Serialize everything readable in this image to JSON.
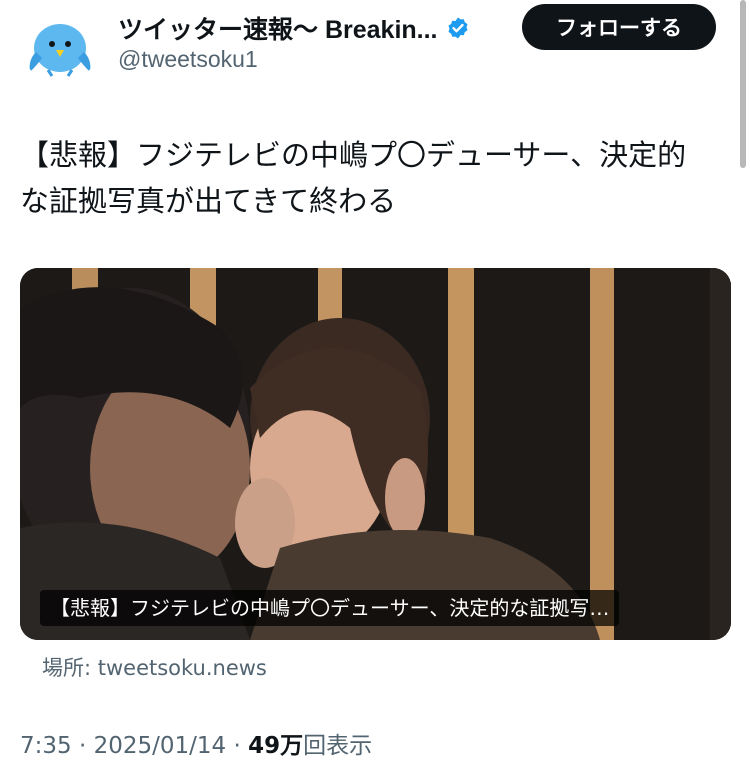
{
  "author": {
    "display_name": "ツイッター速報〜 Breakin...",
    "handle": "@tweetsoku1",
    "avatar_icon": "bird-avatar-icon",
    "verified_icon": "verified-badge-icon",
    "verified_color": "#1d9bf0"
  },
  "follow_button": {
    "label": "フォローする"
  },
  "tweet": {
    "text_line1": "【悲報】フジテレビの中嶋プ〇デューサー、決定的",
    "text_line2": "な証拠写真が出てきて終わる"
  },
  "media": {
    "caption": "【悲報】フジテレビの中嶋プ〇デューサー、決定的な証拠写…"
  },
  "link_source": "場所: tweetsoku.news",
  "meta": {
    "time": "7:35",
    "separator": " · ",
    "date": "2025/01/14",
    "views_count": "49万",
    "views_label": "回表示"
  },
  "colors": {
    "text_primary": "#0f1419",
    "text_secondary": "#536471",
    "button_bg": "#0f1419"
  }
}
